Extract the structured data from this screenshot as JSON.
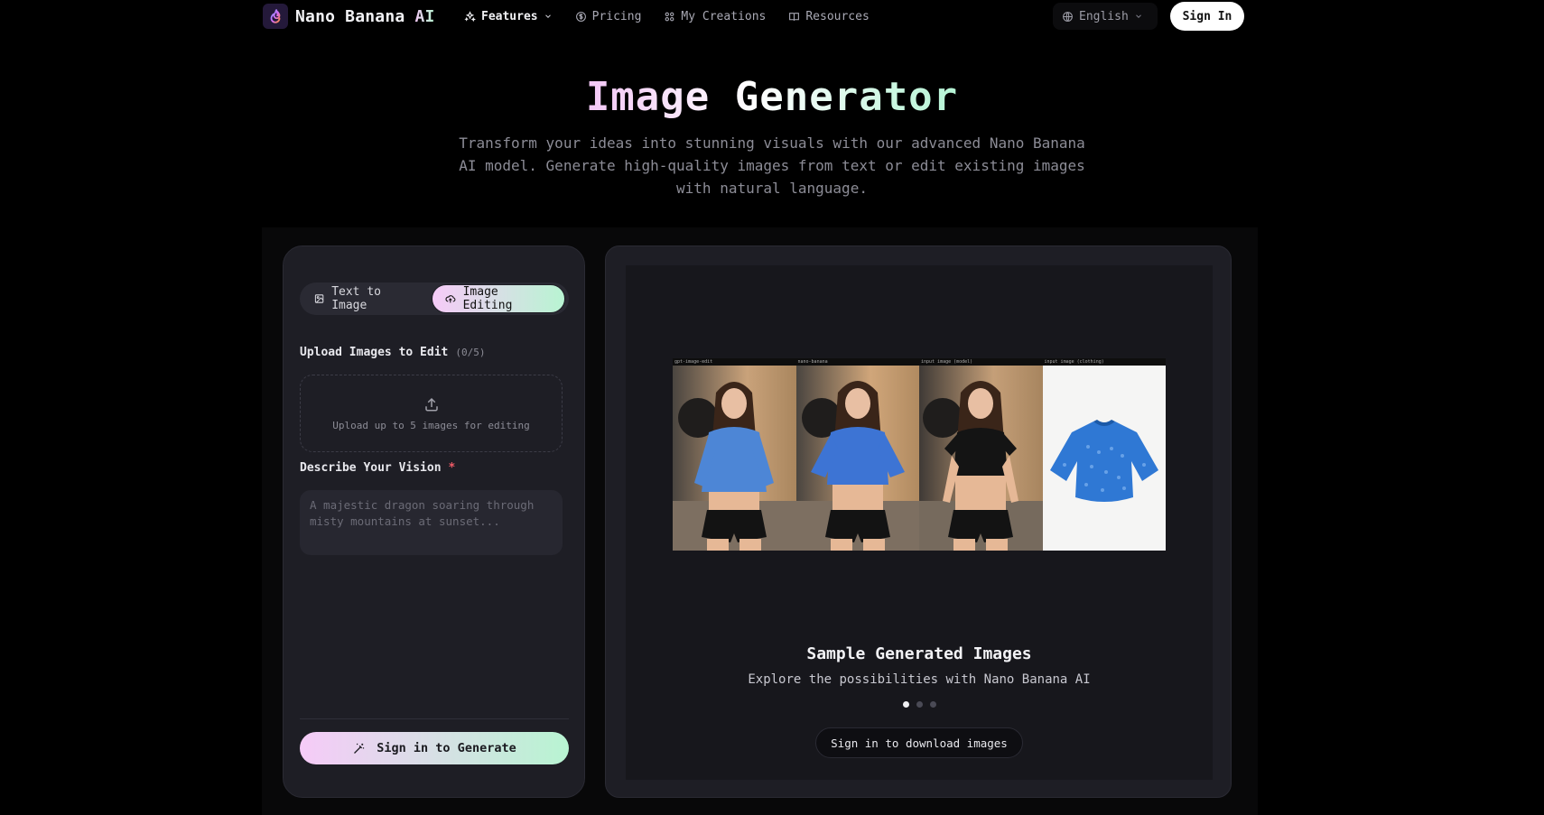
{
  "brand": {
    "name": "Nano Banana",
    "name_suffix": "AI",
    "logo_icon": "flame-logo-icon"
  },
  "nav": {
    "items": [
      {
        "label": "Features",
        "icon": "sparkles-icon",
        "active": true,
        "has_dropdown": true
      },
      {
        "label": "Pricing",
        "icon": "dollar-circle-icon"
      },
      {
        "label": "My Creations",
        "icon": "grid-icon"
      },
      {
        "label": "Resources",
        "icon": "book-icon"
      }
    ],
    "language": "English",
    "sign_in": "Sign In"
  },
  "hero": {
    "title": "Image Generator",
    "subtitle": "Transform your ideas into stunning visuals with our advanced Nano Banana AI model. Generate high-quality images from text or edit existing images with natural language."
  },
  "editor": {
    "tabs": [
      {
        "label": "Text to Image",
        "icon": "image-icon",
        "active": false
      },
      {
        "label": "Image Editing",
        "icon": "upload-cloud-icon",
        "active": true
      }
    ],
    "upload": {
      "label": "Upload Images to Edit",
      "count": "(0/5)",
      "hint": "Upload up to 5 images for editing"
    },
    "prompt": {
      "label": "Describe Your Vision",
      "required_mark": "*",
      "placeholder": "A majestic dragon soaring through misty mountains at sunset..."
    },
    "generate_button": "Sign in to Generate"
  },
  "preview": {
    "image_labels": [
      "gpt-image-edit",
      "nano-banana",
      "input image (model)",
      "input image (clothing)"
    ],
    "title": "Sample Generated Images",
    "subtitle": "Explore the possibilities with Nano Banana AI",
    "slides": 3,
    "active_slide": 1,
    "download_button": "Sign in to download images"
  },
  "colors": {
    "accent_start": "#f6cbf8",
    "accent_end": "#b8f4d2",
    "background": "#000000",
    "card": "#1e1e25",
    "required": "#ef5b67"
  }
}
